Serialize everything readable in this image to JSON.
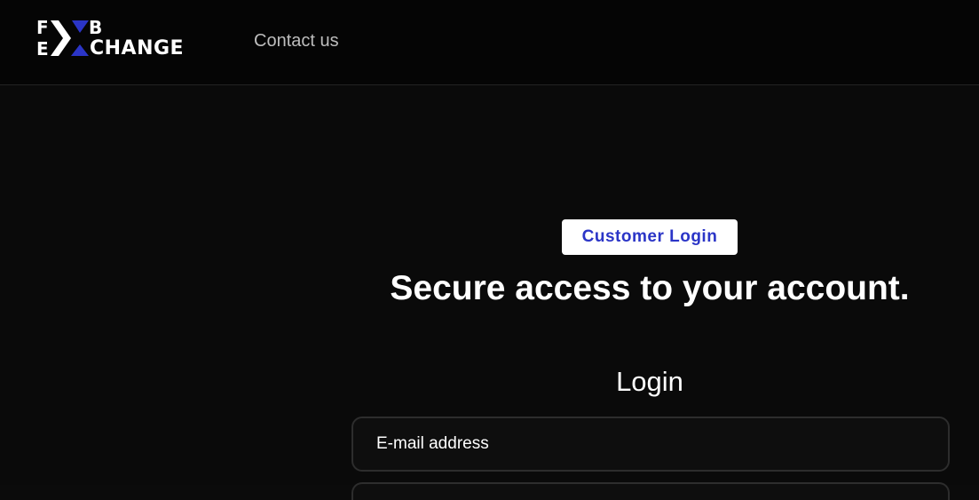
{
  "header": {
    "logo": {
      "letter_f": "F",
      "letter_e": "E",
      "letter_b": "B",
      "word": "CHANGE",
      "accent_color": "#2b35c7"
    },
    "nav": {
      "contact_label": "Contact us"
    }
  },
  "main": {
    "badge_label": "Customer Login",
    "headline": "Secure access to your account.",
    "form_title": "Login",
    "email_placeholder": "E-mail address"
  },
  "colors": {
    "background": "#0b0b0b",
    "header_background": "#050505",
    "badge_text": "#2b35c7",
    "nav_text": "#bdbdbd"
  }
}
